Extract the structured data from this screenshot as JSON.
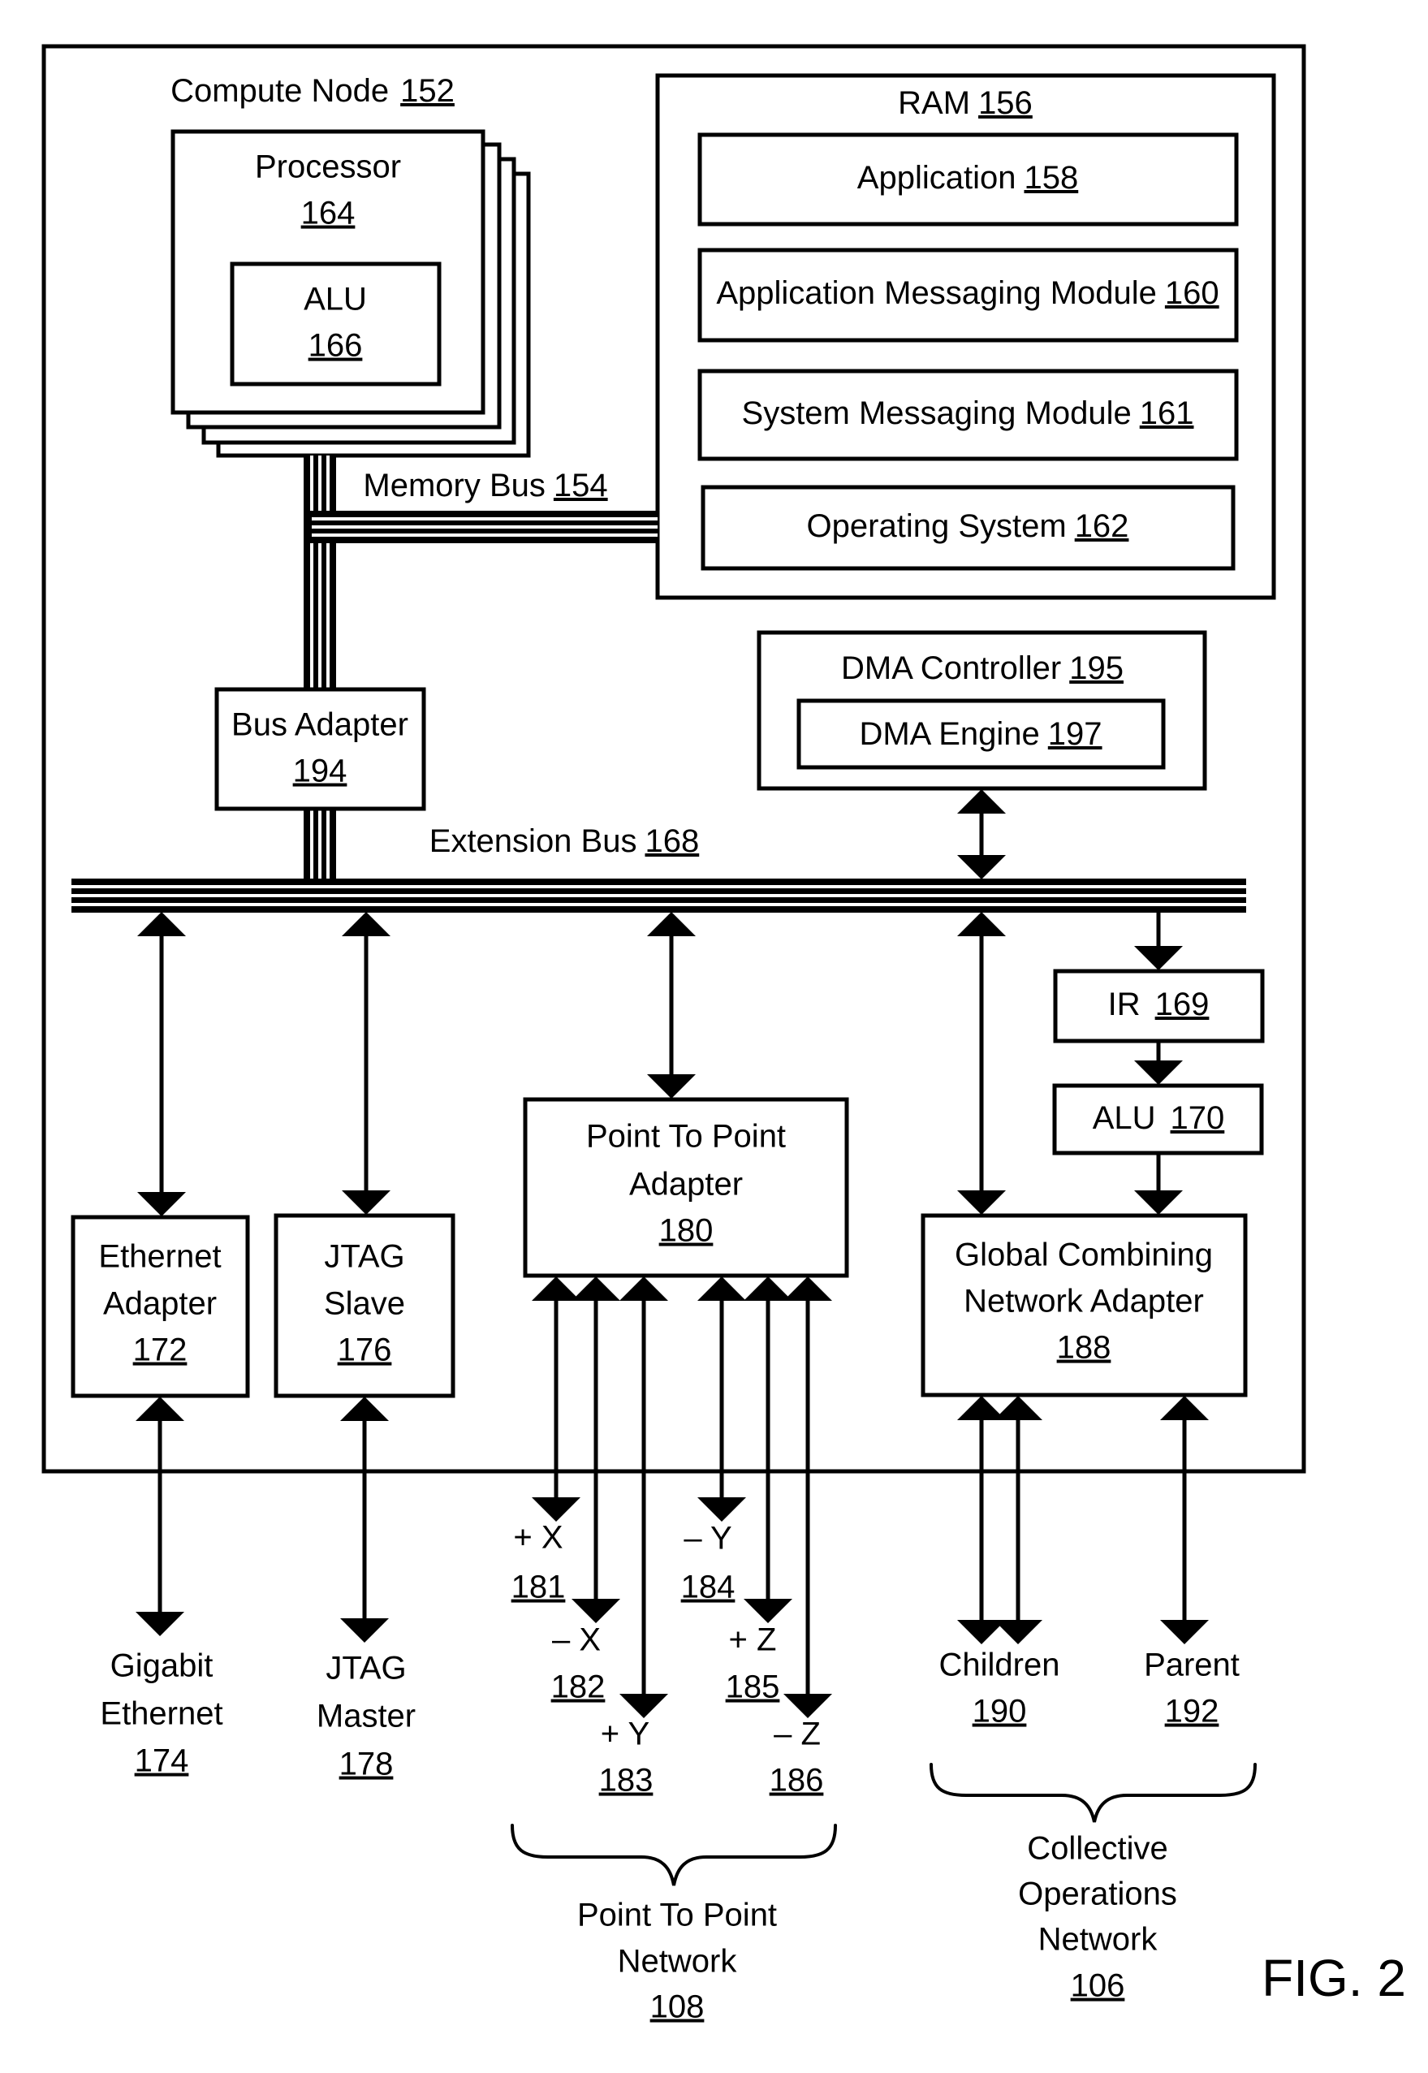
{
  "figure_label": "FIG. 2",
  "compute_node": {
    "label": "Compute Node",
    "ref": "152"
  },
  "processor": {
    "label": "Processor",
    "ref": "164"
  },
  "processor_alu": {
    "label": "ALU",
    "ref": "166"
  },
  "ram": {
    "label": "RAM",
    "ref": "156",
    "modules": [
      {
        "label": "Application",
        "ref": "158"
      },
      {
        "label": "Application Messaging Module",
        "ref": "160"
      },
      {
        "label": "System Messaging Module",
        "ref": "161"
      },
      {
        "label": "Operating System",
        "ref": "162"
      }
    ]
  },
  "memory_bus": {
    "label": "Memory Bus",
    "ref": "154"
  },
  "bus_adapter": {
    "label": "Bus Adapter",
    "ref": "194"
  },
  "dma_controller": {
    "label": "DMA Controller",
    "ref": "195"
  },
  "dma_engine": {
    "label": "DMA Engine",
    "ref": "197"
  },
  "extension_bus": {
    "label": "Extension Bus",
    "ref": "168"
  },
  "ir": {
    "label": "IR",
    "ref": "169"
  },
  "network_alu": {
    "label": "ALU",
    "ref": "170"
  },
  "ethernet_adapter": {
    "line1": "Ethernet",
    "line2": "Adapter",
    "ref": "172"
  },
  "jtag_slave": {
    "line1": "JTAG",
    "line2": "Slave",
    "ref": "176"
  },
  "p2p_adapter": {
    "line1": "Point To Point",
    "line2": "Adapter",
    "ref": "180"
  },
  "gcna": {
    "line1": "Global Combining",
    "line2": "Network Adapter",
    "ref": "188"
  },
  "gigabit_ethernet": {
    "line1": "Gigabit",
    "line2": "Ethernet",
    "ref": "174"
  },
  "jtag_master": {
    "line1": "JTAG",
    "line2": "Master",
    "ref": "178"
  },
  "p2p_links": [
    {
      "label": "+ X",
      "ref": "181"
    },
    {
      "label": "– X",
      "ref": "182"
    },
    {
      "label": "+ Y",
      "ref": "183"
    },
    {
      "label": "– Y",
      "ref": "184"
    },
    {
      "label": "+ Z",
      "ref": "185"
    },
    {
      "label": "– Z",
      "ref": "186"
    }
  ],
  "children": {
    "label": "Children",
    "ref": "190"
  },
  "parent": {
    "label": "Parent",
    "ref": "192"
  },
  "p2p_network": {
    "line1": "Point To Point",
    "line2": "Network",
    "ref": "108"
  },
  "collective_network": {
    "line1": "Collective",
    "line2": "Operations",
    "line3": "Network",
    "ref": "106"
  }
}
